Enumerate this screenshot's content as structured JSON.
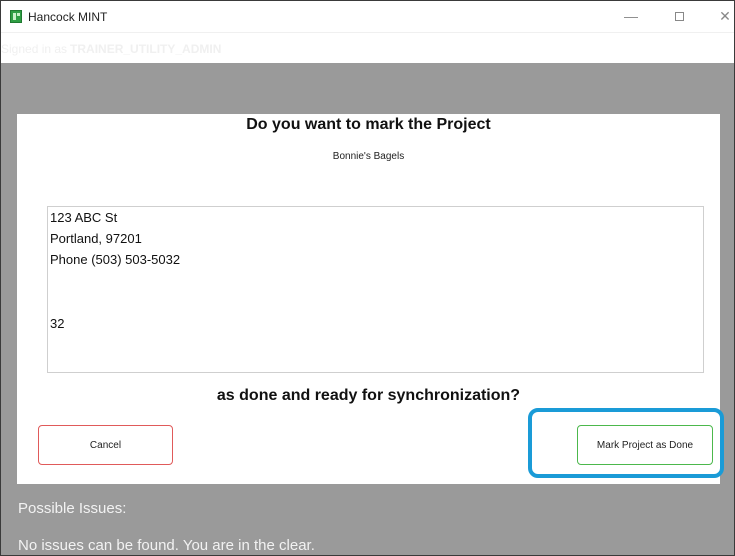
{
  "window": {
    "title": "Hancock MINT",
    "controls": {
      "minimize": "—",
      "close": "✕"
    }
  },
  "signin": {
    "prefix": "Signed in as",
    "user": "TRAINER_UTILITY_ADMIN"
  },
  "dialog": {
    "title": "Do you want to mark the Project",
    "project_name": "Bonnie's Bagels",
    "address_lines": [
      "123 ABC St",
      "Portland, 97201",
      "Phone (503) 503-5032",
      "32"
    ],
    "question": "as done and ready for synchronization?",
    "cancel_label": "Cancel",
    "done_label": "Mark Project as Done"
  },
  "issues": {
    "label": "Possible Issues:",
    "message": "No issues can be found. You are in the clear."
  },
  "colors": {
    "highlight": "#1a9bd7",
    "cancel_border": "#e05a5a",
    "done_border": "#4cb84c",
    "app_icon": "#2f9e44"
  },
  "icons": [
    "app-icon",
    "minimize-icon",
    "maximize-icon",
    "close-icon"
  ]
}
